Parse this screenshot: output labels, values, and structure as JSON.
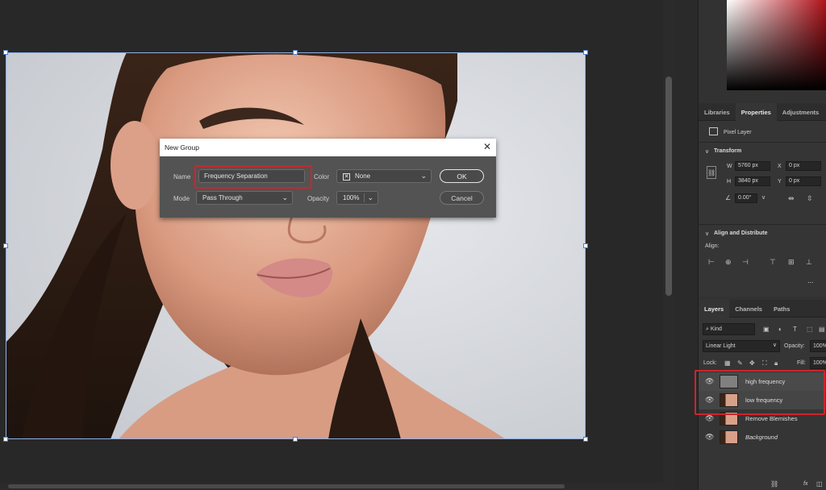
{
  "dialog": {
    "title": "New Group",
    "close_glyph": "✕",
    "name_label": "Name",
    "name_value": "Frequency Separation",
    "color_label": "Color",
    "color_value": "None",
    "mode_label": "Mode",
    "mode_value": "Pass Through",
    "opacity_label": "Opacity",
    "opacity_value": "100%",
    "ok_label": "OK",
    "cancel_label": "Cancel"
  },
  "panel_tabs": [
    {
      "label": "Libraries"
    },
    {
      "label": "Properties"
    },
    {
      "label": "Adjustments"
    }
  ],
  "properties": {
    "pixel_layer_label": "Pixel Layer",
    "transform_label": "Transform",
    "w_label": "W",
    "w_value": "5760 px",
    "h_label": "H",
    "h_value": "3840 px",
    "x_label": "X",
    "x_value": "0 px",
    "y_label": "Y",
    "y_value": "0 px",
    "angle_value": "0.00°",
    "align_distribute_label": "Align and Distribute",
    "align_label": "Align:",
    "more_glyph": "..."
  },
  "layers_tabs": [
    {
      "label": "Layers"
    },
    {
      "label": "Channels"
    },
    {
      "label": "Paths"
    }
  ],
  "layers_panel": {
    "filter_kind": "Kind",
    "blend_mode": "Linear Light",
    "opacity_label": "Opacity:",
    "opacity_value": "100%",
    "lock_label": "Lock:",
    "fill_label": "Fill:",
    "fill_value": "100%",
    "fx_label": "fx"
  },
  "layers": [
    {
      "name": "high frequency",
      "italic": false
    },
    {
      "name": "low frequency",
      "italic": false
    },
    {
      "name": "Remove Blemishes",
      "italic": false
    },
    {
      "name": "Background",
      "italic": true
    }
  ],
  "colors": {
    "highlight_red": "#d0242b",
    "selection_blue": "#4a7fd0"
  }
}
